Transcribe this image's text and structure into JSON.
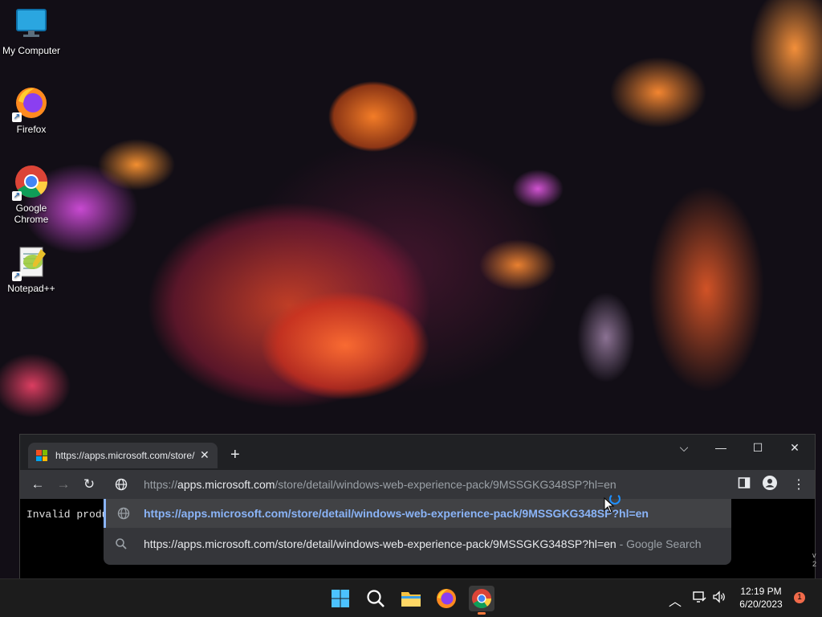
{
  "desktop": {
    "icons": [
      {
        "label_line1": "My Computer",
        "label_line2": ""
      },
      {
        "label_line1": "Firefox",
        "label_line2": ""
      },
      {
        "label_line1": "Google",
        "label_line2": "Chrome"
      },
      {
        "label_line1": "Notepad++",
        "label_line2": ""
      }
    ]
  },
  "browser": {
    "tab_title": "https://apps.microsoft.com/store/",
    "omnibox": {
      "prefix": "https://",
      "host": "apps.microsoft.com",
      "path": "/store/detail/windows-web-experience-pack/9MSSGKG348SP?hl=en"
    },
    "suggestions": [
      {
        "text": "https://apps.microsoft.com/store/detail/windows-web-experience-pack/9MSSGKG348SP?hl=en",
        "suffix": "",
        "icon": "globe-icon"
      },
      {
        "text": "https://apps.microsoft.com/store/detail/windows-web-experience-pack/9MSSGKG348SP?hl=en",
        "suffix": "- Google Search",
        "icon": "search-icon"
      }
    ],
    "page_text": "Invalid produ"
  },
  "taskbar": {
    "time": "12:19 PM",
    "date": "6/20/2023",
    "notification_count": "1"
  },
  "colors": {
    "accent_link": "#8ab4f8",
    "active_indicator": "#ff7b3d"
  }
}
